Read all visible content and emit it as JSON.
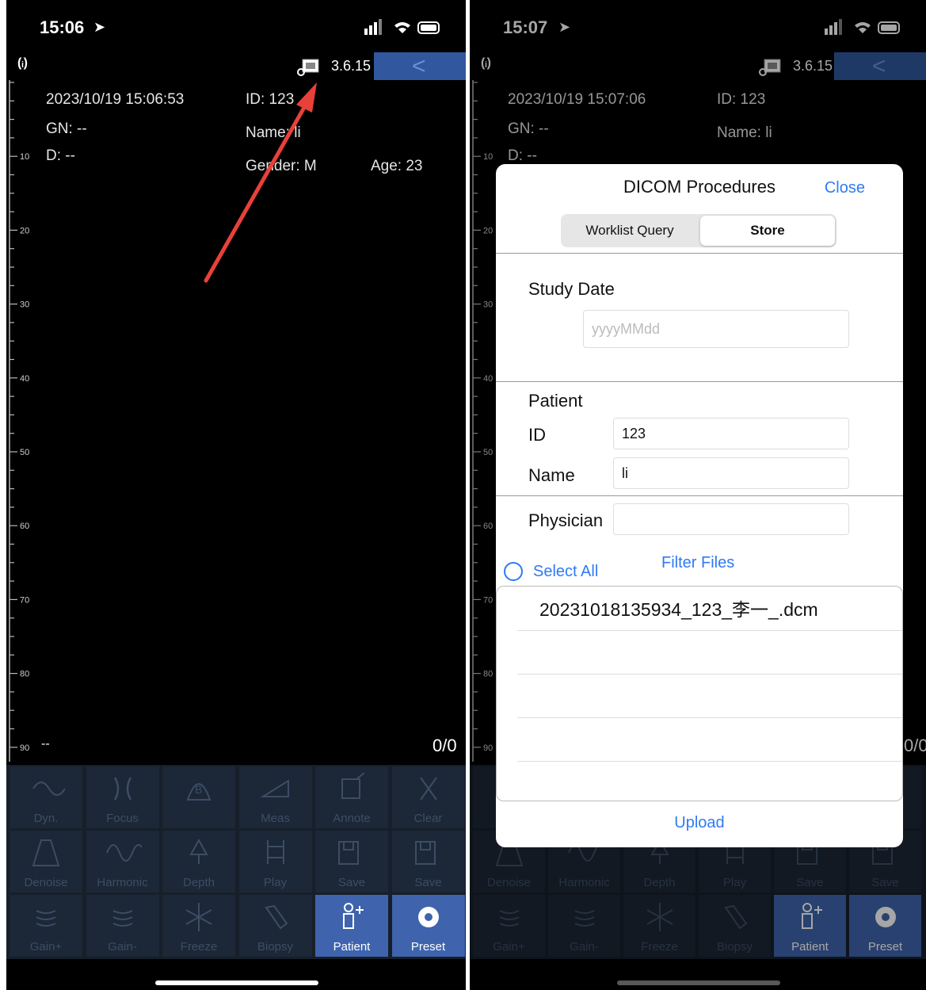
{
  "left": {
    "status_time": "15:06",
    "version": "3.6.15",
    "datetime": "2023/10/19 15:06:53",
    "id": "ID: 123",
    "gn": "GN: --",
    "name": "Name: li",
    "d": "D: --",
    "gender": "Gender: M",
    "age": "Age: 23",
    "frame_counter": "0/0",
    "depth_readout": "--"
  },
  "right": {
    "status_time": "15:07",
    "version": "3.6.15",
    "datetime": "2023/10/19 15:07:06",
    "id": "ID: 123",
    "gn": "GN: --",
    "name": "Name: li",
    "d": "D: --",
    "frame_counter": "0/0"
  },
  "scale_ticks": [
    "10",
    "20",
    "30",
    "40",
    "50",
    "60",
    "70",
    "80",
    "90"
  ],
  "toolbar": {
    "row1": [
      "Dyn.",
      "Focus",
      "",
      "Meas",
      "Annote",
      "Clear"
    ],
    "row2": [
      "Denoise",
      "Harmonic",
      "Depth",
      "Play",
      "Save",
      "Save"
    ],
    "row3": [
      "Gain+",
      "Gain-",
      "Freeze",
      "Biopsy",
      "Patient",
      "Preset"
    ]
  },
  "dicom": {
    "title": "DICOM Procedures",
    "close": "Close",
    "tabs": [
      "Worklist Query",
      "Store"
    ],
    "active_tab": "Store",
    "study_date_label": "Study Date",
    "study_date_placeholder": "yyyyMMdd",
    "patient_label": "Patient",
    "id_label": "ID",
    "id_value": "123",
    "name_label": "Name",
    "name_value": "li",
    "physician_label": "Physician",
    "physician_value": "",
    "select_all": "Select All",
    "filter_files": "Filter Files",
    "files": [
      "20231018135934_123_李一_.dcm",
      "",
      "",
      "",
      ""
    ],
    "upload": "Upload"
  },
  "colors": {
    "accent_blue": "#2f7af5",
    "toolbar_bg": "#1c2737",
    "active_tool": "#3f64ad",
    "topbar_back": "#31589f",
    "arrow": "#e8413a"
  }
}
